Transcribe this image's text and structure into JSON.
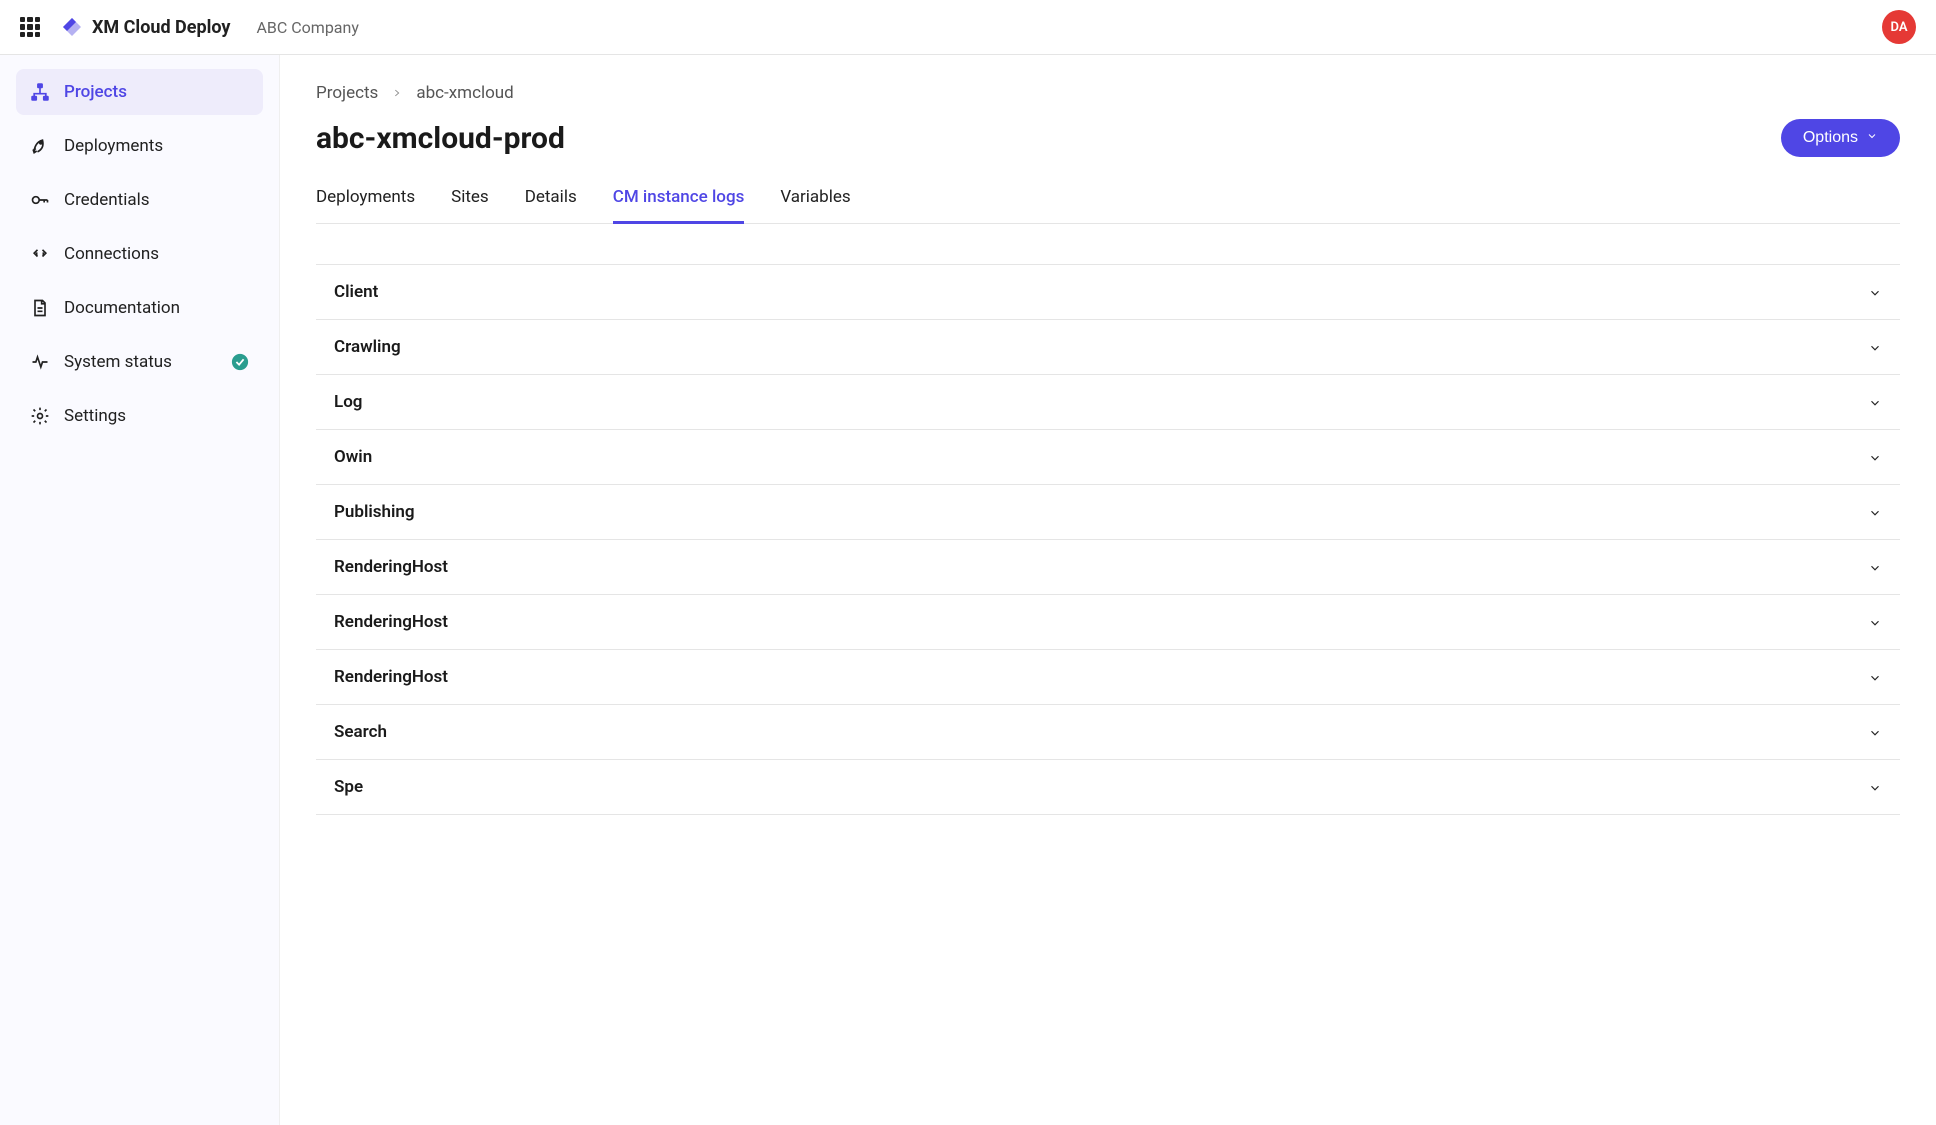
{
  "header": {
    "brand_title": "XM Cloud Deploy",
    "company_name": "ABC Company",
    "avatar_initials": "DA"
  },
  "sidebar": {
    "items": [
      {
        "icon": "sitemap-icon",
        "label": "Projects",
        "active": true
      },
      {
        "icon": "rocket-icon",
        "label": "Deployments",
        "active": false
      },
      {
        "icon": "key-icon",
        "label": "Credentials",
        "active": false
      },
      {
        "icon": "plug-icon",
        "label": "Connections",
        "active": false
      },
      {
        "icon": "document-icon",
        "label": "Documentation",
        "active": false
      },
      {
        "icon": "heartbeat-icon",
        "label": "System status",
        "active": false,
        "status_ok": true
      },
      {
        "icon": "gear-icon",
        "label": "Settings",
        "active": false
      }
    ]
  },
  "breadcrumb": {
    "root": "Projects",
    "current": "abc-xmcloud"
  },
  "page": {
    "title": "abc-xmcloud-prod",
    "options_label": "Options"
  },
  "tabs": [
    {
      "label": "Deployments",
      "active": false
    },
    {
      "label": "Sites",
      "active": false
    },
    {
      "label": "Details",
      "active": false
    },
    {
      "label": "CM instance logs",
      "active": true
    },
    {
      "label": "Variables",
      "active": false
    }
  ],
  "logs": [
    {
      "label": "Client"
    },
    {
      "label": "Crawling"
    },
    {
      "label": "Log"
    },
    {
      "label": "Owin"
    },
    {
      "label": "Publishing"
    },
    {
      "label": "RenderingHost"
    },
    {
      "label": "RenderingHost"
    },
    {
      "label": "RenderingHost"
    },
    {
      "label": "Search"
    },
    {
      "label": "Spe"
    }
  ],
  "colors": {
    "accent": "#4f46e5",
    "avatar_bg": "#e53935",
    "status_ok": "#2a9d8f"
  }
}
